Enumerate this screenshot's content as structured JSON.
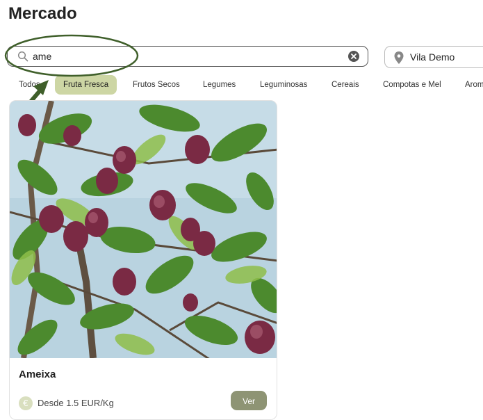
{
  "page": {
    "title": "Mercado"
  },
  "search": {
    "value": "ame",
    "icon": "search-icon",
    "clear_icon": "clear-icon"
  },
  "location": {
    "label": "Vila Demo",
    "icon": "map-pin-icon"
  },
  "categories": [
    {
      "label": "Todos",
      "active": false
    },
    {
      "label": "Fruta Fresca",
      "active": true
    },
    {
      "label": "Frutos Secos",
      "active": false
    },
    {
      "label": "Legumes",
      "active": false
    },
    {
      "label": "Leguminosas",
      "active": false
    },
    {
      "label": "Cereais",
      "active": false
    },
    {
      "label": "Compotas e Mel",
      "active": false
    },
    {
      "label": "Arom",
      "active": false
    }
  ],
  "products": [
    {
      "name": "Ameixa",
      "price_label": "Desde 1.5 EUR/Kg",
      "currency_icon": "euro-icon",
      "button_label": "Ver"
    }
  ],
  "colors": {
    "accent_category": "#cdd6a4",
    "button": "#8e9474",
    "annotation": "#3f5f2a"
  }
}
